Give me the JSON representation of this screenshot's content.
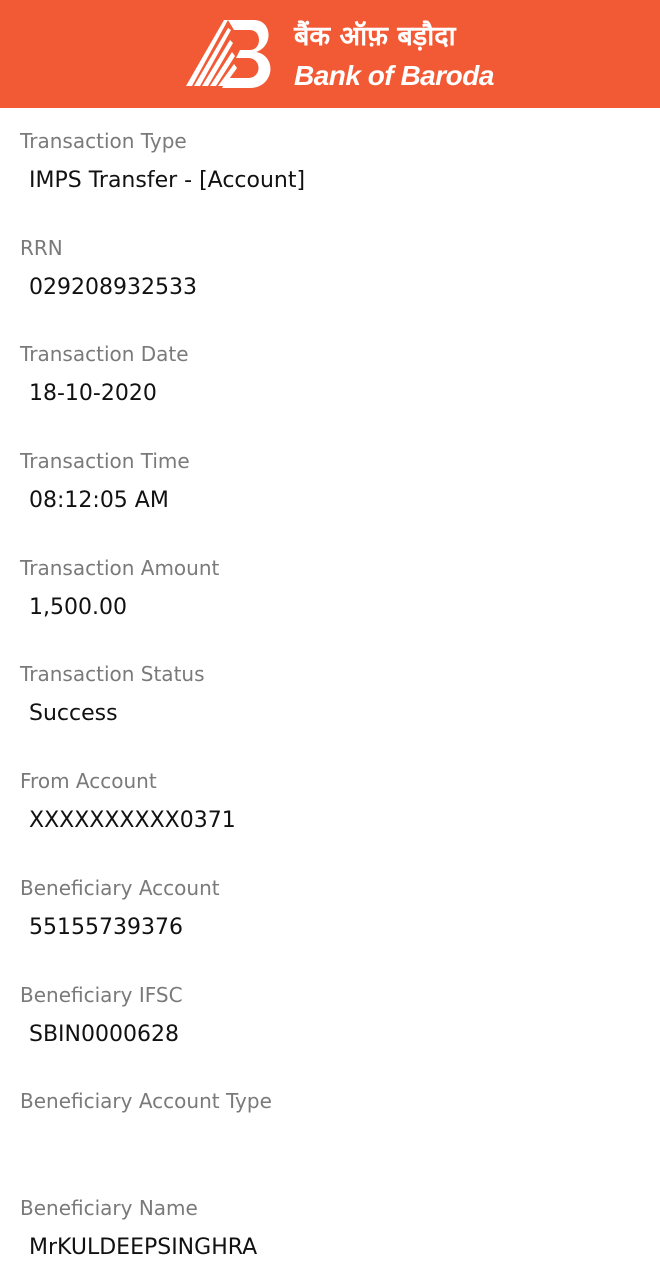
{
  "header": {
    "bank_name_hindi": "बैंक ऑफ़ बड़ौदा",
    "bank_name_english": "Bank of Baroda",
    "background_color": "#f25a36",
    "logo_icon": "bank-of-baroda-logo-icon"
  },
  "fields": [
    {
      "label": "Transaction Type",
      "value": "IMPS Transfer - [Account]"
    },
    {
      "label": "RRN",
      "value": "029208932533"
    },
    {
      "label": "Transaction Date",
      "value": "18-10-2020"
    },
    {
      "label": "Transaction Time",
      "value": "08:12:05 AM"
    },
    {
      "label": "Transaction Amount",
      "value": "1,500.00"
    },
    {
      "label": "Transaction Status",
      "value": "Success"
    },
    {
      "label": "From Account",
      "value": "XXXXXXXXXX0371"
    },
    {
      "label": "Beneficiary Account",
      "value": "55155739376"
    },
    {
      "label": "Beneficiary IFSC",
      "value": "SBIN0000628"
    },
    {
      "label": "Beneficiary Account Type",
      "value": ""
    },
    {
      "label": "Beneficiary Name",
      "value": "MrKULDEEPSINGHRA"
    }
  ]
}
